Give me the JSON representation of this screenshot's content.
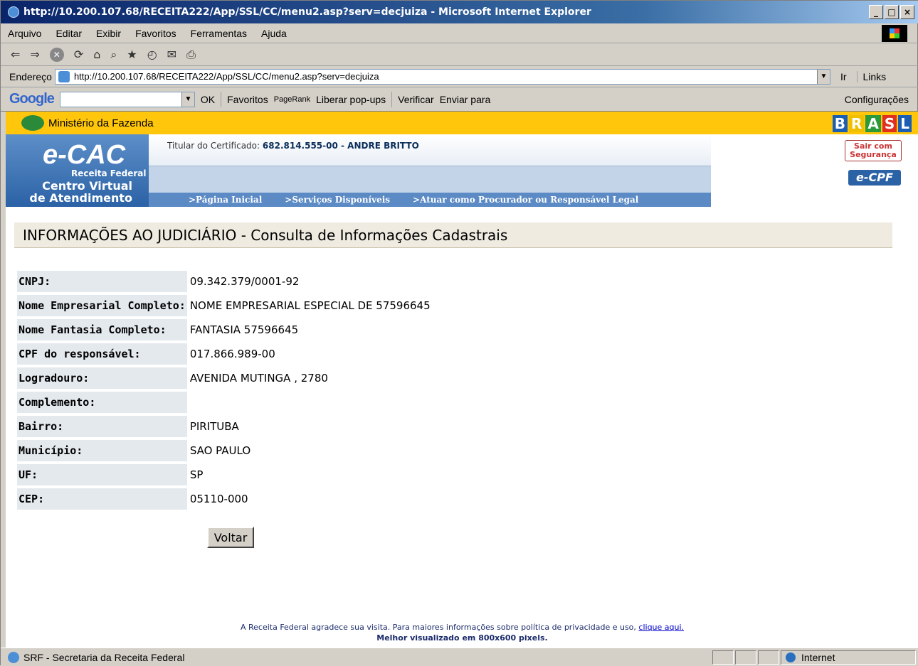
{
  "window": {
    "title": "http://10.200.107.68/RECEITA222/App/SSL/CC/menu2.asp?serv=decjuiza - Microsoft Internet Explorer",
    "btn_min": "_",
    "btn_max": "□",
    "btn_close": "×"
  },
  "menu": {
    "items": [
      "Arquivo",
      "Editar",
      "Exibir",
      "Favoritos",
      "Ferramentas",
      "Ajuda"
    ]
  },
  "toolbar": {
    "back": "⇐",
    "forward": "⇒",
    "stop": "✕",
    "refresh": "⟳",
    "home": "⌂",
    "search": "⌕",
    "favorites": "★",
    "history": "◴",
    "mail": "✉",
    "print": "⎙"
  },
  "address": {
    "label": "Endereço",
    "url": "http://10.200.107.68/RECEITA222/App/SSL/CC/menu2.asp?serv=decjuiza",
    "go": "Ir",
    "links": "Links"
  },
  "google": {
    "logo": "Google",
    "g": "G",
    "ok": "OK",
    "favoritos": "Favoritos",
    "pagerank": "PageRank",
    "popups": "Liberar pop-ups",
    "verificar": "Verificar",
    "enviar": "Enviar para",
    "config": "Configurações"
  },
  "site": {
    "ministerio": "Ministério da Fazenda",
    "brasil": [
      "B",
      "R",
      "A",
      "S",
      "L"
    ],
    "ecac": "e-CAC",
    "receita": "Receita Federal",
    "cv1": "Centro Virtual",
    "cv2": "de Atendimento",
    "cert_label": "Titular do Certificado:",
    "cert_value": "682.814.555-00 - ANDRE BRITTO",
    "sair": "Sair com Segurança",
    "ecpf": "e-CPF",
    "nav": [
      ">Página Inicial",
      ">Serviços Disponíveis",
      ">Atuar como Procurador ou Responsável Legal"
    ]
  },
  "heading": "INFORMAÇÕES AO JUDICIÁRIO - Consulta de Informações Cadastrais",
  "fields": [
    {
      "label": "CNPJ:",
      "value": "09.342.379/0001-92"
    },
    {
      "label": "Nome Empresarial Completo:",
      "value": "NOME EMPRESARIAL ESPECIAL DE 57596645"
    },
    {
      "label": "Nome Fantasia Completo:",
      "value": "FANTASIA 57596645"
    },
    {
      "label": "CPF do responsável:",
      "value": "017.866.989-00"
    },
    {
      "label": "Logradouro:",
      "value": "AVENIDA MUTINGA , 2780"
    },
    {
      "label": "Complemento:",
      "value": ""
    },
    {
      "label": "Bairro:",
      "value": "PIRITUBA"
    },
    {
      "label": "Município:",
      "value": "SAO PAULO"
    },
    {
      "label": "UF:",
      "value": "SP"
    },
    {
      "label": "CEP:",
      "value": "05110-000"
    }
  ],
  "voltar": "Voltar",
  "footer": {
    "text": "A Receita Federal agradece sua visita. Para maiores informações sobre política de privacidade e uso, ",
    "link": "clique aqui.",
    "best": "Melhor visualizado em 800x600 pixels."
  },
  "status": {
    "text": "SRF - Secretaria da Receita Federal",
    "zone": "Internet"
  },
  "colors": {
    "title_bar": "#0a246a",
    "ministerio_bar": "#ffc60b",
    "nav": "#5b8ac5",
    "label_bg": "#e4e9ee",
    "heading_bg": "#efebe0"
  }
}
